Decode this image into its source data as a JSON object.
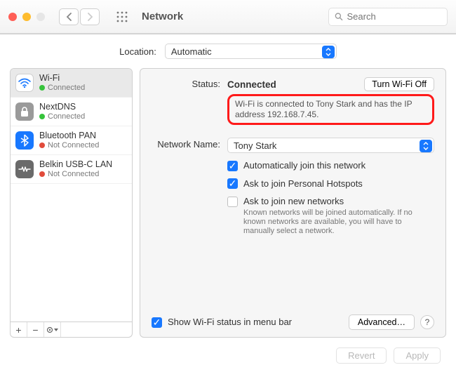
{
  "window": {
    "title": "Network"
  },
  "search": {
    "placeholder": "Search"
  },
  "location": {
    "label": "Location:",
    "value": "Automatic"
  },
  "services": [
    {
      "name": "Wi-Fi",
      "status": "Connected",
      "connected": true,
      "icon": "wifi",
      "selected": true
    },
    {
      "name": "NextDNS",
      "status": "Connected",
      "connected": true,
      "icon": "lock",
      "selected": false
    },
    {
      "name": "Bluetooth PAN",
      "status": "Not Connected",
      "connected": false,
      "icon": "bt",
      "selected": false
    },
    {
      "name": "Belkin USB-C LAN",
      "status": "Not Connected",
      "connected": false,
      "icon": "eth",
      "selected": false
    }
  ],
  "detail": {
    "status_label": "Status:",
    "status_value": "Connected",
    "toggle_label": "Turn Wi-Fi Off",
    "status_desc": "Wi-Fi is connected to Tony Stark and has the IP address 192.168.7.45.",
    "network_label": "Network Name:",
    "network_value": "Tony Stark",
    "opt_autojoin": "Automatically join this network",
    "opt_hotspot": "Ask to join Personal Hotspots",
    "opt_asknew": "Ask to join new networks",
    "asknew_hint": "Known networks will be joined automatically. If no known networks are available, you will have to manually select a network.",
    "show_menu": "Show Wi-Fi status in menu bar",
    "advanced": "Advanced…",
    "help": "?"
  },
  "footer": {
    "revert": "Revert",
    "apply": "Apply"
  }
}
